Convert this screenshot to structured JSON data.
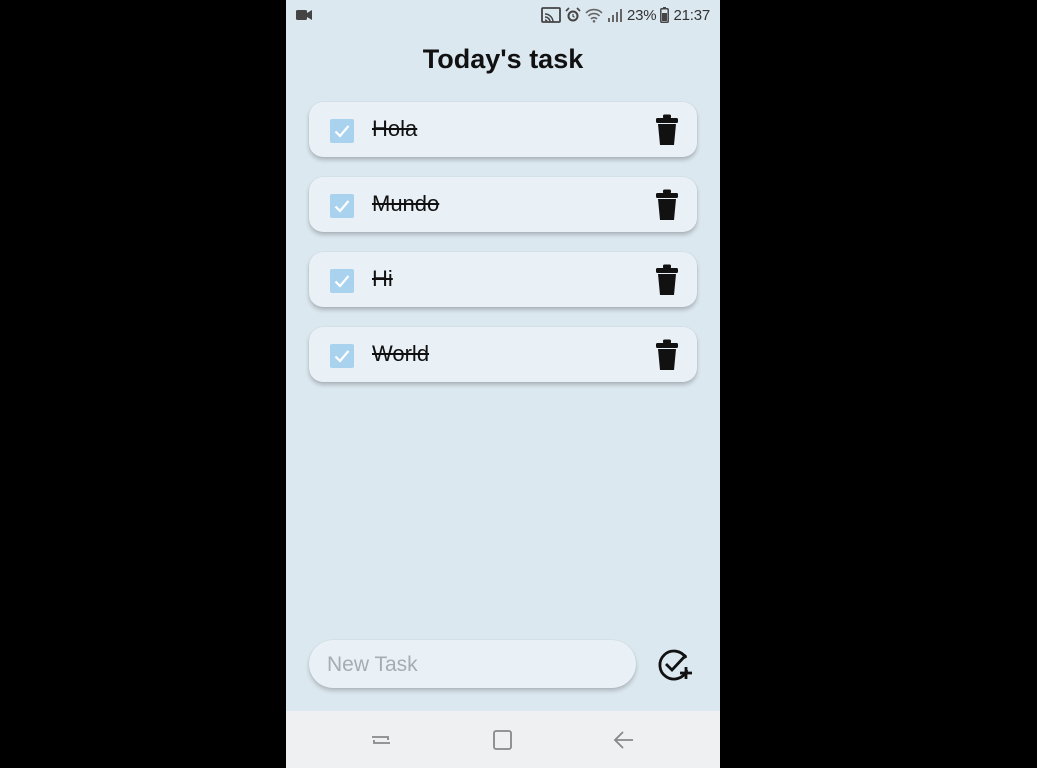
{
  "status_bar": {
    "left_icon": "video-icon",
    "icons": [
      "cast-icon",
      "alarm-icon",
      "wifi-icon",
      "signal-icon"
    ],
    "battery_percent": "23%",
    "battery_icon": "battery-icon",
    "time": "21:37"
  },
  "title": "Today's task",
  "tasks": [
    {
      "label": "Hola",
      "completed": true
    },
    {
      "label": "Mundo",
      "completed": true
    },
    {
      "label": "Hi",
      "completed": true
    },
    {
      "label": "World",
      "completed": true
    }
  ],
  "task_icons": {
    "checkbox": "checkbox-checked-icon",
    "delete": "trash-icon"
  },
  "new_task": {
    "placeholder": "New Task",
    "value": ""
  },
  "add_button_icon": "check-plus-icon",
  "nav": [
    "recent-apps-icon",
    "home-icon",
    "back-icon"
  ],
  "colors": {
    "background": "#dce8f0",
    "card": "#eaf1f6",
    "checkbox": "#a9d2ee",
    "navbar": "#eef0f1"
  }
}
